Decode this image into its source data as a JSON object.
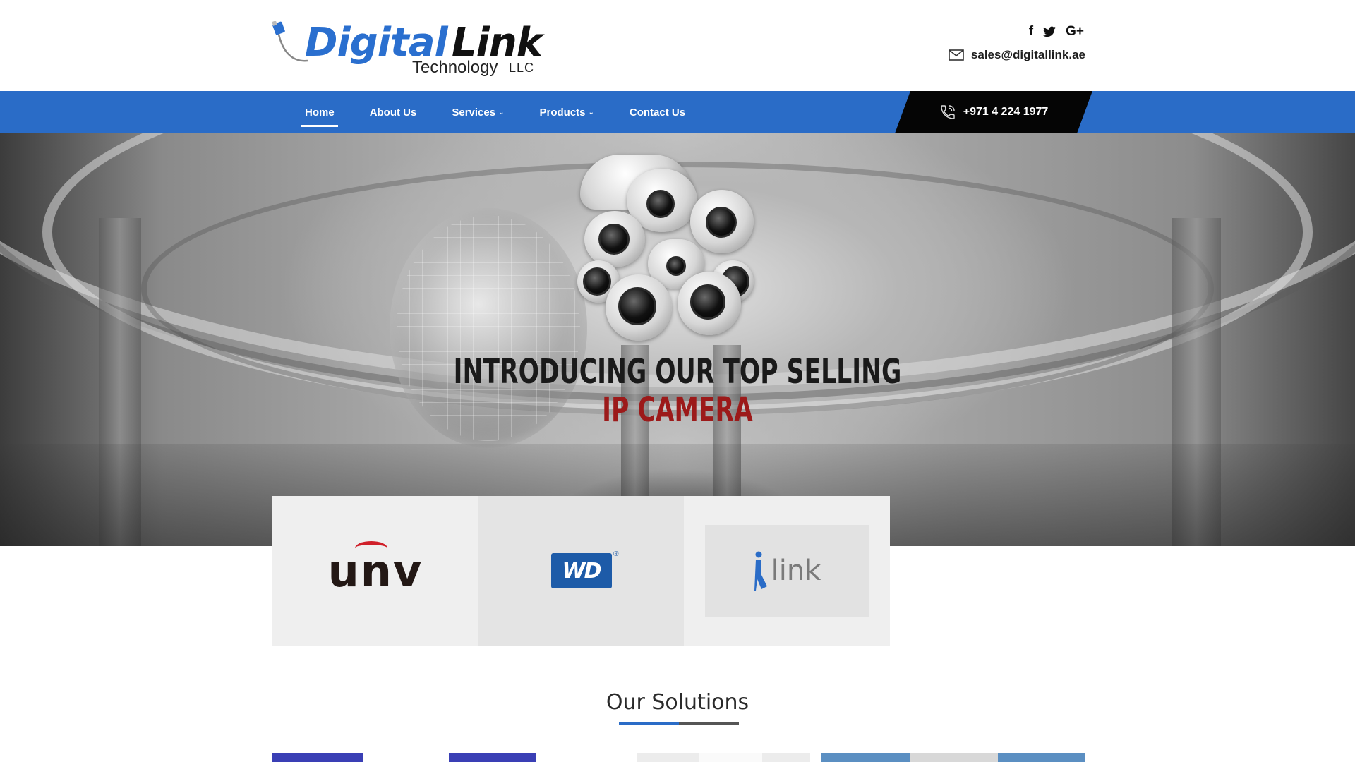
{
  "header": {
    "logo": {
      "word1": "Digital",
      "word2": "Link",
      "sub": "Technology",
      "suffix": "LLC"
    },
    "social": [
      {
        "icon": "facebook-icon",
        "glyph": "f"
      },
      {
        "icon": "twitter-icon",
        "glyph": "🐦"
      },
      {
        "icon": "google-plus-icon",
        "glyph": "G+"
      }
    ],
    "email": "sales@digitallink.ae"
  },
  "nav": {
    "items": [
      {
        "label": "Home",
        "active": true,
        "dropdown": false
      },
      {
        "label": "About Us",
        "active": false,
        "dropdown": false
      },
      {
        "label": "Services",
        "active": false,
        "dropdown": true
      },
      {
        "label": "Products",
        "active": false,
        "dropdown": true
      },
      {
        "label": "Contact Us",
        "active": false,
        "dropdown": false
      }
    ],
    "phone": "+971 4 224 1977"
  },
  "hero": {
    "line1": "INTRODUCING OUR TOP SELLING",
    "line2": "IP CAMERA"
  },
  "brands": [
    {
      "name": "unv",
      "text": "unv"
    },
    {
      "name": "wd",
      "text": "WD"
    },
    {
      "name": "ilink",
      "text": "link"
    }
  ],
  "solutions": {
    "title": "Our Solutions"
  },
  "colors": {
    "brand_blue": "#2a6cc7",
    "nav_dark": "#050505",
    "hero_red": "#9c1a1a"
  }
}
